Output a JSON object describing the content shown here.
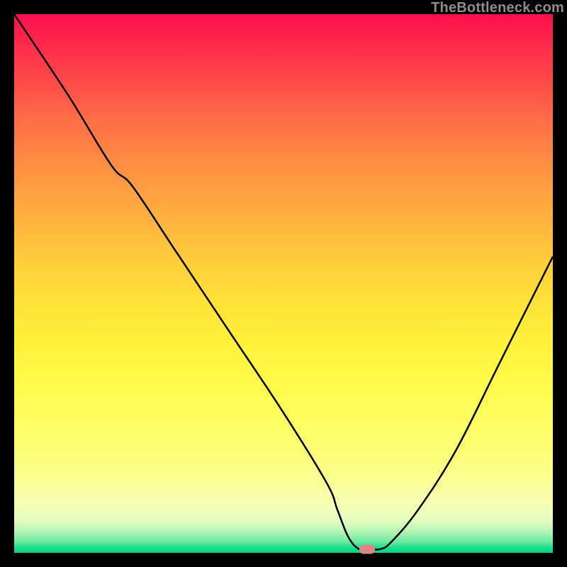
{
  "watermark": "TheBottleneck.com",
  "marker": {
    "x_pct": 65.5,
    "y_pct": 99.3
  },
  "chart_data": {
    "type": "line",
    "title": "",
    "xlabel": "",
    "ylabel": "",
    "xlim": [
      0,
      100
    ],
    "ylim": [
      0,
      100
    ],
    "x": [
      0,
      10,
      18,
      22,
      30,
      40,
      50,
      58,
      60,
      62,
      64,
      66,
      68,
      70,
      75,
      82,
      90,
      100
    ],
    "values": [
      100,
      85,
      72,
      68,
      56,
      41,
      26,
      13,
      8,
      3,
      0.7,
      0.7,
      0.7,
      2,
      8,
      19,
      35,
      55
    ],
    "annotations": [
      {
        "x": 65.5,
        "y": 0.7,
        "label": "marker"
      }
    ]
  }
}
